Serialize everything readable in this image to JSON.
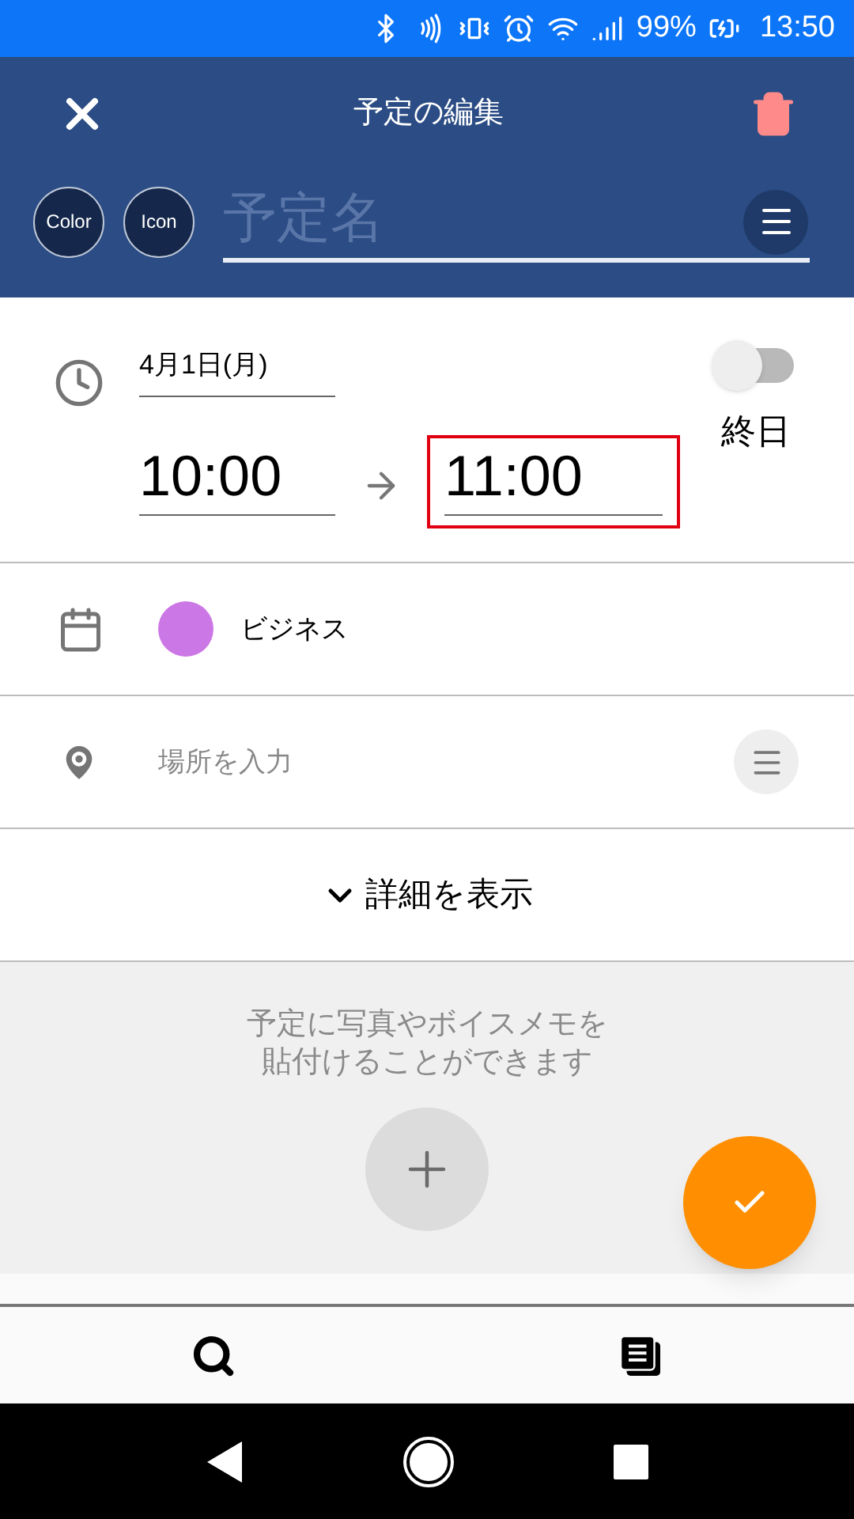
{
  "status_bar": {
    "battery": "99%",
    "time": "13:50"
  },
  "header": {
    "title": "予定の編集"
  },
  "name_row": {
    "color_button": "Color",
    "icon_button": "Icon",
    "placeholder": "予定名"
  },
  "datetime": {
    "date": "4月1日(月)",
    "start": "10:00",
    "end": "11:00",
    "end_highlighted": true,
    "all_day": {
      "label": "終日",
      "on": false
    }
  },
  "calendar": {
    "name": "ビジネス",
    "color": "#cc77e6"
  },
  "location": {
    "placeholder": "場所を入力"
  },
  "details": {
    "label": "詳細を表示"
  },
  "attachments": {
    "hint": [
      "予定に写真やボイスメモを",
      "貼付けることができます"
    ]
  }
}
